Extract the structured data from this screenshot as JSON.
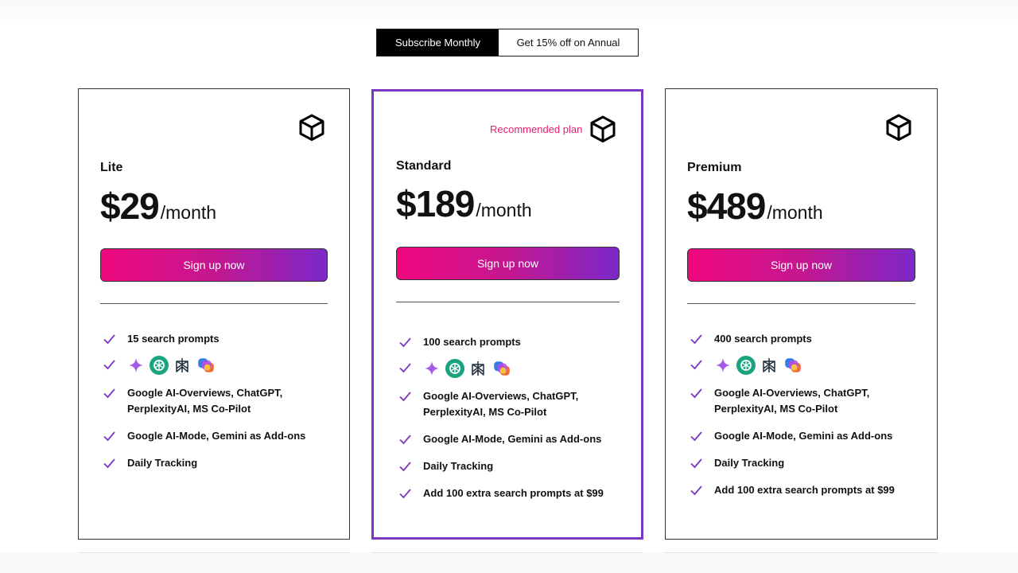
{
  "toggle": {
    "monthly_label": "Subscribe Monthly",
    "annual_label": "Get 15% off on Annual",
    "selected": "monthly"
  },
  "colors": {
    "accent_purple": "#7b36c4",
    "recommended_pink": "#e0206e",
    "button_gradient_start": "#f0087f",
    "button_gradient_end": "#7c28c9"
  },
  "plans": [
    {
      "name": "Lite",
      "price": "$29",
      "period": "/month",
      "cta": "Sign up now",
      "features": [
        "15 search prompts",
        "",
        "Google AI-Overviews, ChatGPT, PerplexityAI, MS Co-Pilot",
        "Google AI-Mode, Gemini as Add-ons",
        "Daily Tracking"
      ]
    },
    {
      "name": "Standard",
      "badge": "Recommended plan",
      "price": "$189",
      "period": "/month",
      "cta": "Sign up now",
      "features": [
        "100 search prompts",
        "",
        "Google AI-Overviews, ChatGPT, PerplexityAI, MS Co-Pilot",
        "Google AI-Mode, Gemini as Add-ons",
        "Daily Tracking",
        "Add 100 extra search prompts at $99"
      ]
    },
    {
      "name": "Premium",
      "price": "$489",
      "period": "/month",
      "cta": "Sign up now",
      "features": [
        "400 search prompts",
        "",
        "Google AI-Overviews, ChatGPT, PerplexityAI, MS Co-Pilot",
        "Google AI-Mode, Gemini as Add-ons",
        "Daily Tracking",
        "Add 100 extra search prompts at $99"
      ]
    }
  ],
  "icons": {
    "plan_icon": "cube-icon",
    "feature_marker": "check-icon",
    "ai_icons": [
      "gemini-sparkle-icon",
      "chatgpt-icon",
      "perplexity-icon",
      "copilot-icon"
    ]
  }
}
